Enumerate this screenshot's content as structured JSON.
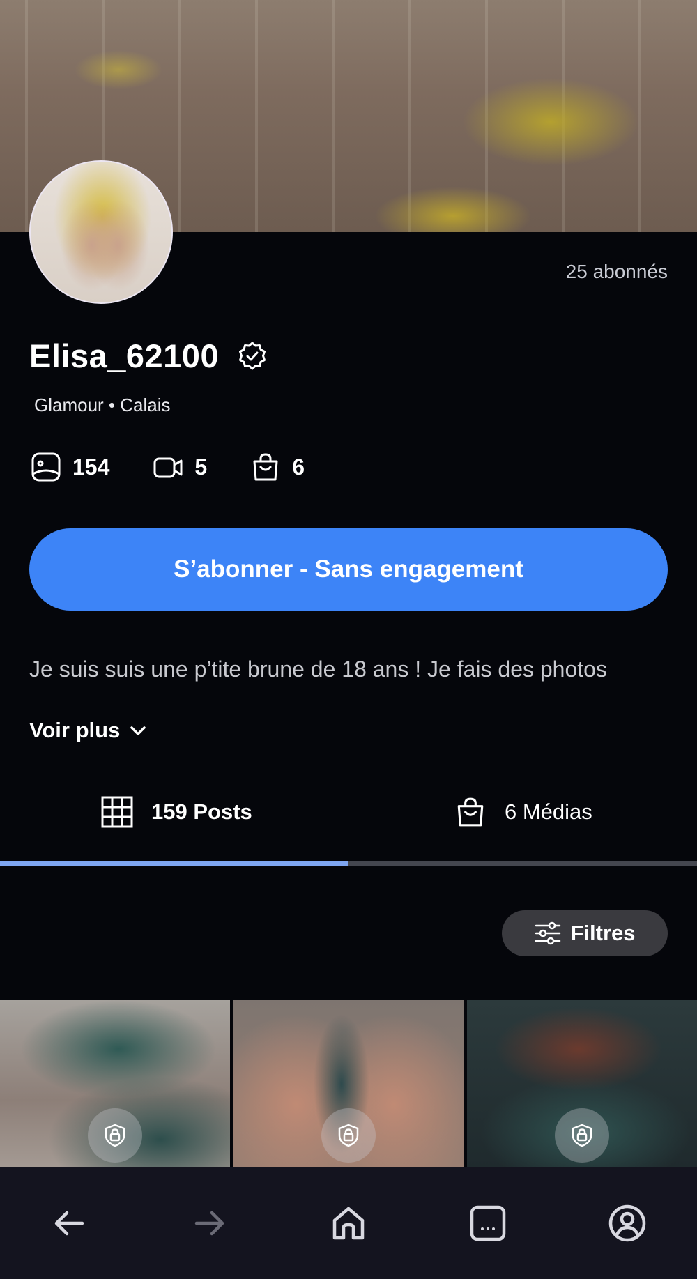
{
  "profile": {
    "followers": "25 abonnés",
    "name": "Elisa_62100",
    "tagline": "Glamour • Calais",
    "stats": {
      "photos": "154",
      "videos": "5",
      "products": "6"
    },
    "subscribe_label": "S’abonner - Sans engagement",
    "bio": "Je suis suis une p’tite brune de 18 ans ! Je fais des photos",
    "see_more": "Voir plus"
  },
  "tabs": {
    "posts_label": "159 Posts",
    "medias_label": "6 Médias",
    "active": "posts"
  },
  "filters_label": "Filtres",
  "grid": {
    "tiles": [
      {
        "locked": true
      },
      {
        "locked": true
      },
      {
        "locked": true
      }
    ]
  },
  "icons": {
    "verified": "verified-badge-icon",
    "photo": "photo-icon",
    "video": "video-camera-icon",
    "bag": "shopping-bag-icon",
    "grid": "grid-icon",
    "filters": "sliders-icon",
    "lock": "lock-icon"
  },
  "colors": {
    "background": "#05060b",
    "accent": "#3d84f7",
    "tab_active": "#7ea5f1",
    "navbar": "#14141f"
  }
}
